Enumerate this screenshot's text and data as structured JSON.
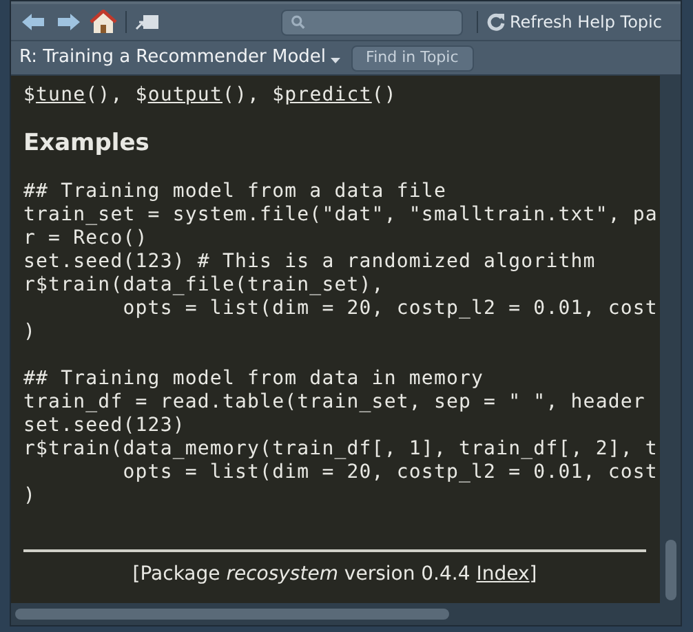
{
  "toolbar": {
    "refresh_button": {
      "label": "Refresh Help Topic"
    }
  },
  "topic_bar": {
    "title": "R: Training a Recommender Model",
    "find_button": {
      "label": "Find in Topic"
    }
  },
  "content": {
    "methods": [
      {
        "sigil": "$",
        "name": "tune",
        "parens": "(),"
      },
      {
        "sigil": "$",
        "name": "output",
        "parens": "(),"
      },
      {
        "sigil": "$",
        "name": "predict",
        "parens": "()"
      }
    ],
    "heading": "Examples",
    "code_blocks": [
      [
        "## Training model from a data file",
        "train_set = system.file(\"dat\", \"smalltrain.txt\", pa",
        "r = Reco()",
        "set.seed(123) # This is a randomized algorithm",
        "r$train(data_file(train_set),",
        "        opts = list(dim = 20, costp_l2 = 0.01, cost",
        ")"
      ],
      [
        "## Training model from data in memory",
        "train_df = read.table(train_set, sep = \" \", header",
        "set.seed(123)",
        "r$train(data_memory(train_df[, 1], train_df[, 2], t",
        "        opts = list(dim = 20, costp_l2 = 0.01, cost",
        ")"
      ]
    ],
    "footer": {
      "text": "[Package *recosystem* version 0.4.4",
      "link": "Index",
      "end": "]"
    }
  }
}
